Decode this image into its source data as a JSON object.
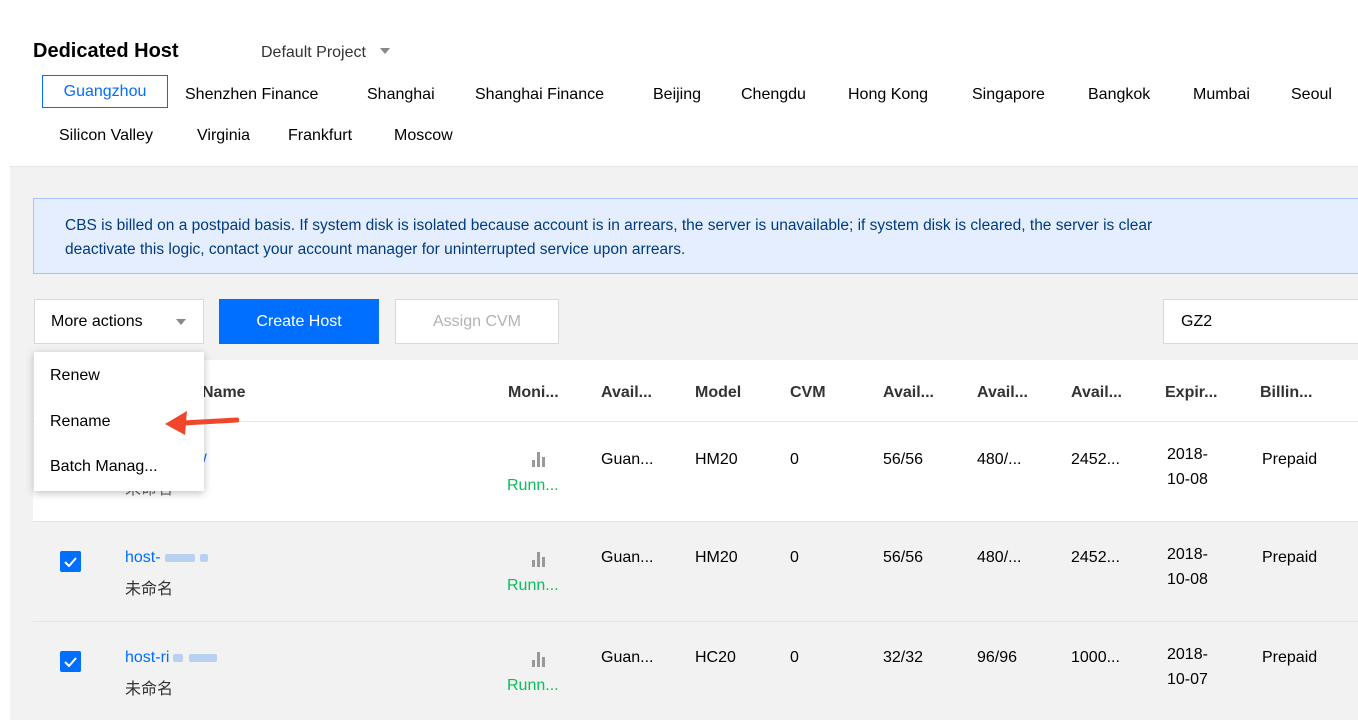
{
  "header": {
    "title": "Dedicated Host",
    "project": "Default Project",
    "regions": [
      "Guangzhou",
      "Shenzhen Finance",
      "Shanghai",
      "Shanghai Finance",
      "Beijing",
      "Chengdu",
      "Hong Kong",
      "Singapore",
      "Bangkok",
      "Mumbai",
      "Seoul",
      "Silicon Valley",
      "Virginia",
      "Frankfurt",
      "Moscow"
    ],
    "active_region": "Guangzhou"
  },
  "notice": {
    "line1": "CBS is billed on a postpaid basis. If system disk is isolated because account is in arrears, the server is unavailable; if system disk is cleared, the server is clear",
    "line2": "deactivate this logic, contact your account manager for uninterrupted service upon arrears."
  },
  "toolbar": {
    "more_actions": "More actions",
    "create_host": "Create Host",
    "assign_cvm": "Assign CVM",
    "zone_value": "GZ2"
  },
  "dropdown": {
    "items": [
      "Renew",
      "Rename",
      "Batch Manag..."
    ]
  },
  "table": {
    "headers": [
      "Name",
      "Moni...",
      "Avail...",
      "Model",
      "CVM",
      "Avail...",
      "Avail...",
      "Avail...",
      "Expir...",
      "Billin..."
    ],
    "rows": [
      {
        "id_suffix": "x5t8w",
        "alias": "未命名",
        "monitor": "Runn...",
        "zone": "Guan...",
        "model": "HM20",
        "cvm": "0",
        "cpu": "56/56",
        "mem": "480/...",
        "disk": "2452...",
        "expire_y": "2018-",
        "expire_md": "10-08",
        "billing": "Prepaid",
        "checked": false
      },
      {
        "id_prefix": "host-",
        "alias": "未命名",
        "monitor": "Runn...",
        "zone": "Guan...",
        "model": "HM20",
        "cvm": "0",
        "cpu": "56/56",
        "mem": "480/...",
        "disk": "2452...",
        "expire_y": "2018-",
        "expire_md": "10-08",
        "billing": "Prepaid",
        "checked": true
      },
      {
        "id_prefix": "host-ri",
        "alias": "未命名",
        "monitor": "Runn...",
        "zone": "Guan...",
        "model": "HC20",
        "cvm": "0",
        "cpu": "32/32",
        "mem": "96/96",
        "disk": "1000...",
        "expire_y": "2018-",
        "expire_md": "10-07",
        "billing": "Prepaid",
        "checked": true
      }
    ]
  },
  "colors": {
    "accent": "#006eff",
    "running": "#0abf5b",
    "arrow": "#f0472b",
    "notice_bg": "#e5eefe"
  },
  "icons": [
    "chevron-down-icon",
    "monitor-bar-icon",
    "checkmark-icon",
    "red-arrow-icon"
  ]
}
